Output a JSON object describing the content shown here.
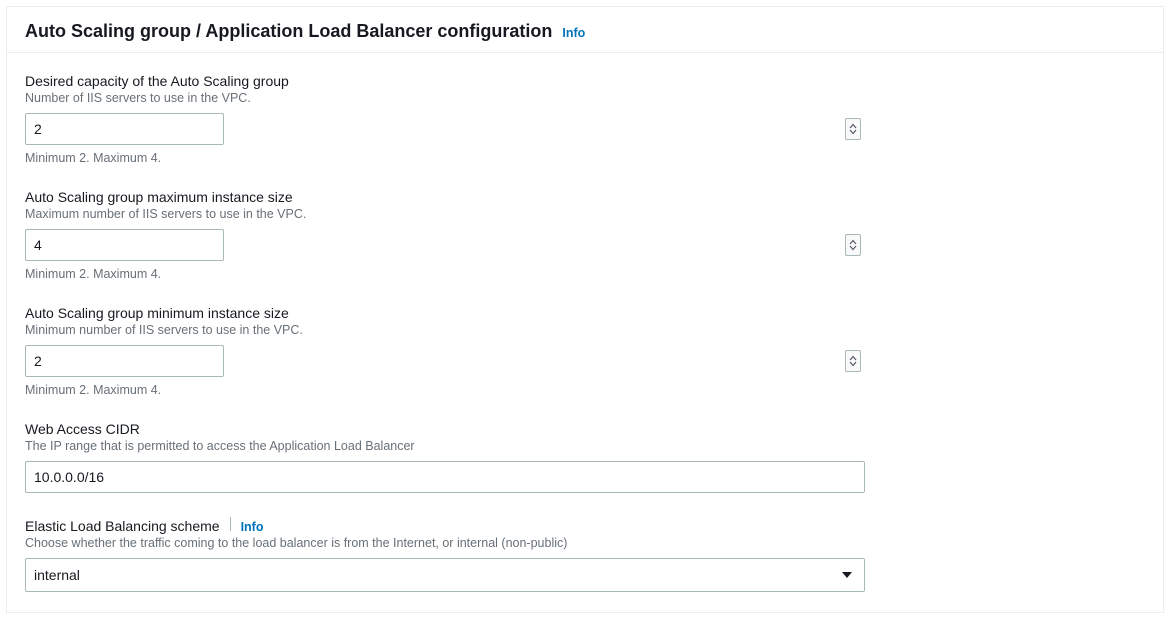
{
  "header": {
    "title": "Auto Scaling group / Application Load Balancer configuration",
    "info_label": "Info"
  },
  "fields": {
    "desired_capacity": {
      "label": "Desired capacity of the Auto Scaling group",
      "description": "Number of IIS servers to use in the VPC.",
      "value": "2",
      "constraint": "Minimum 2. Maximum 4."
    },
    "max_instance_size": {
      "label": "Auto Scaling group maximum instance size",
      "description": "Maximum number of IIS servers to use in the VPC.",
      "value": "4",
      "constraint": "Minimum 2. Maximum 4."
    },
    "min_instance_size": {
      "label": "Auto Scaling group minimum instance size",
      "description": "Minimum number of IIS servers to use in the VPC.",
      "value": "2",
      "constraint": "Minimum 2. Maximum 4."
    },
    "web_access_cidr": {
      "label": "Web Access CIDR",
      "description": "The IP range that is permitted to access the Application Load Balancer",
      "value": "10.0.0.0/16"
    },
    "elb_scheme": {
      "label": "Elastic Load Balancing scheme",
      "info_label": "Info",
      "description": "Choose whether the traffic coming to the load balancer is from the Internet, or internal (non-public)",
      "value": "internal"
    }
  }
}
